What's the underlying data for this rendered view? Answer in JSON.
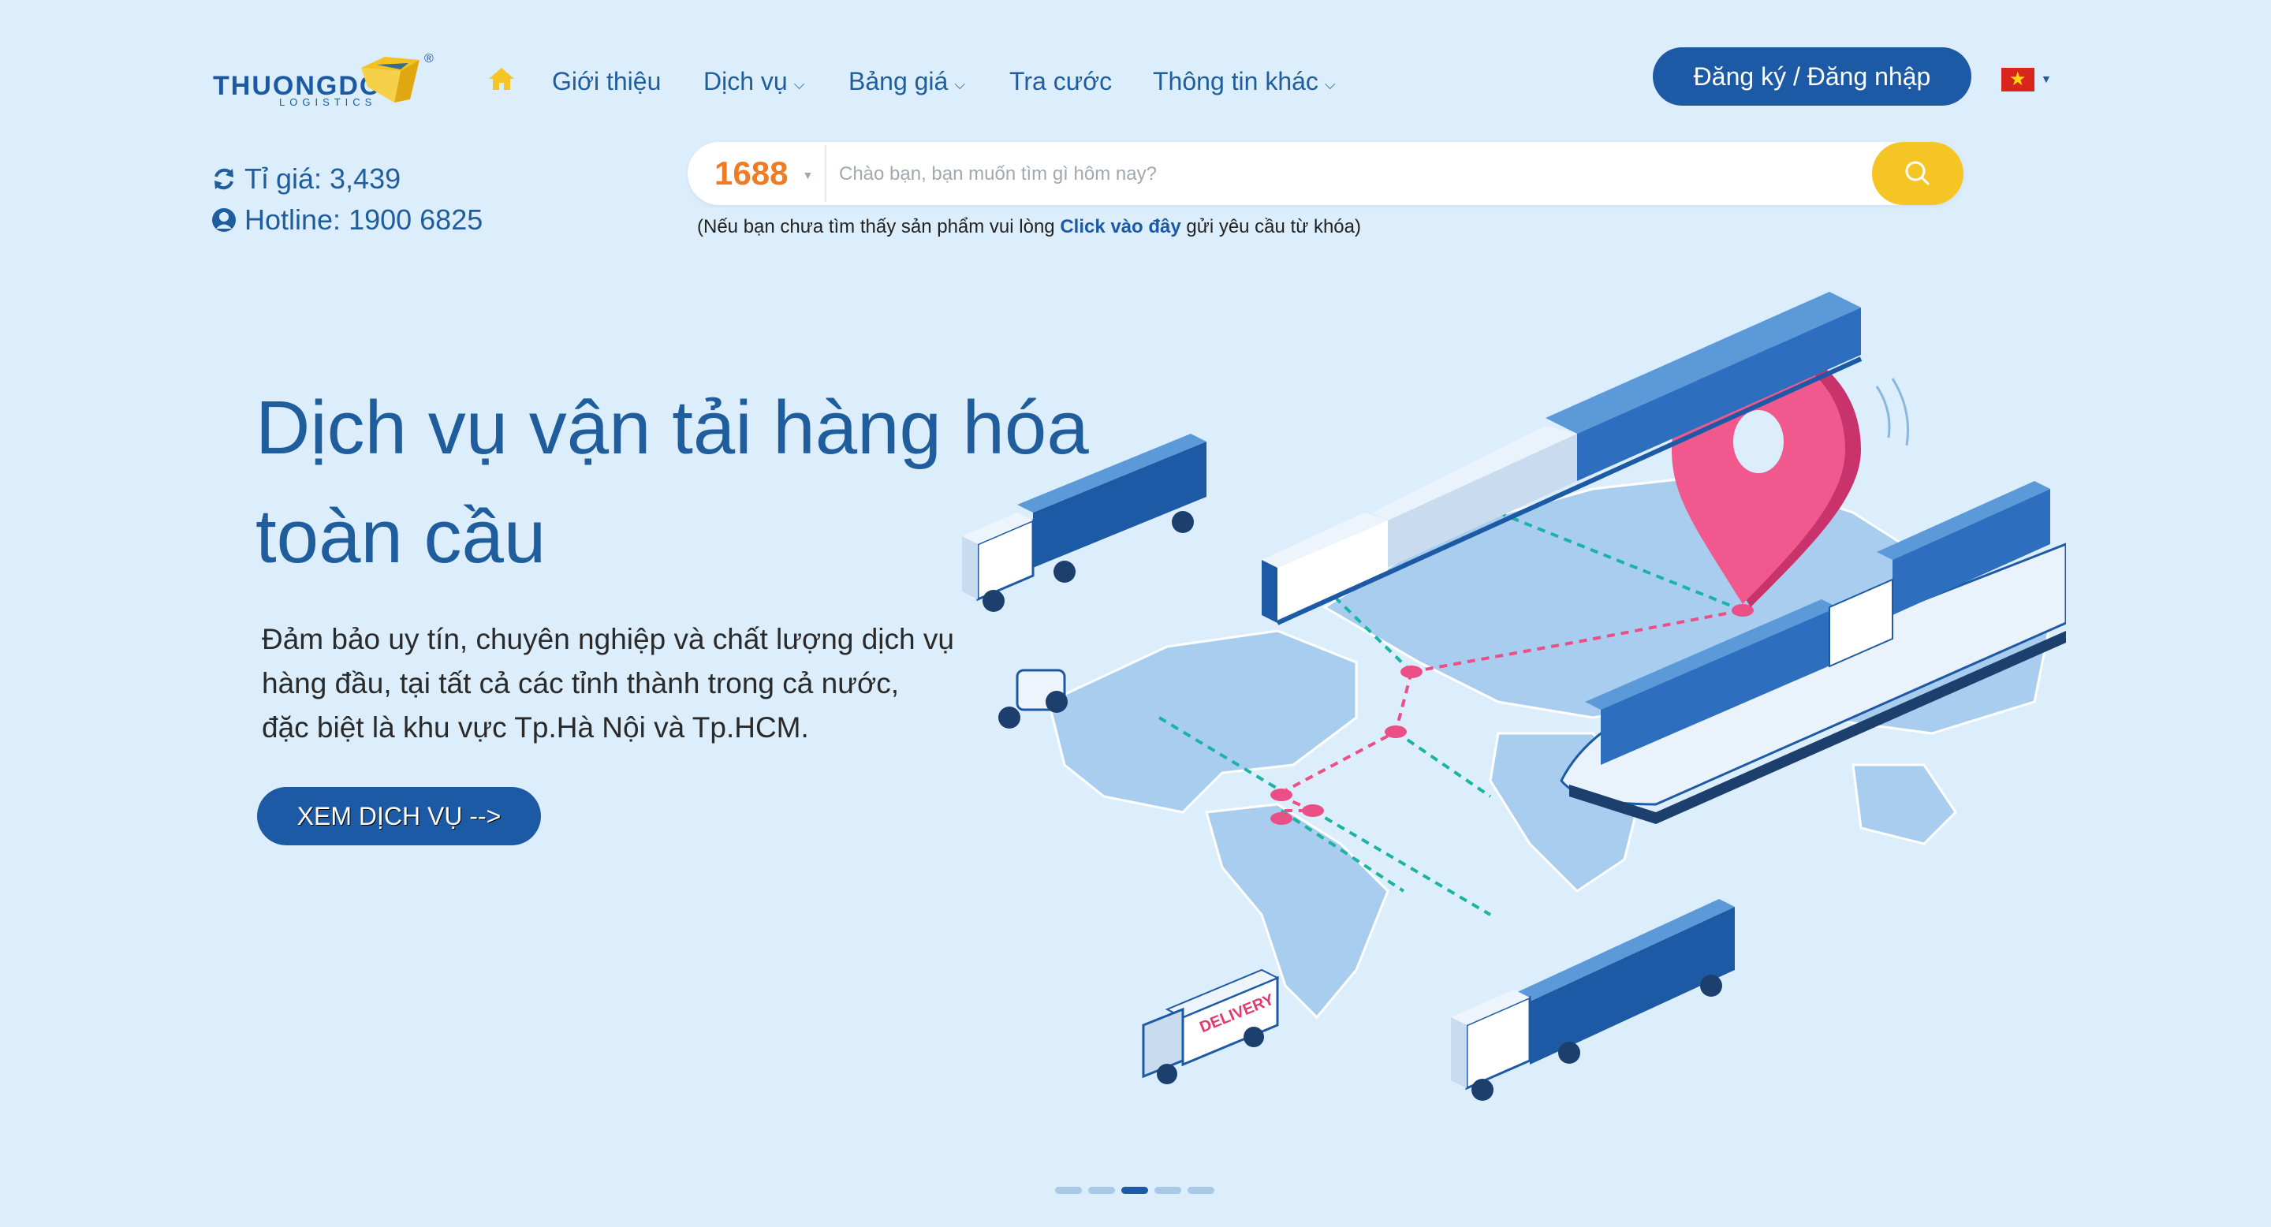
{
  "brand": {
    "name": "THUONGDO",
    "sub": "LOGISTICS"
  },
  "nav": {
    "items": [
      {
        "label": "Giới thiệu",
        "dropdown": false
      },
      {
        "label": "Dịch vụ",
        "dropdown": true
      },
      {
        "label": "Bảng giá",
        "dropdown": true
      },
      {
        "label": "Tra cước",
        "dropdown": false
      },
      {
        "label": "Thông tin khác",
        "dropdown": true
      }
    ],
    "auth_label": "Đăng ký / Đăng nhập",
    "language_icon": "vietnam-flag-icon"
  },
  "info": {
    "rate": "Tỉ giá: 3,439",
    "hotline": "Hotline: 1900 6825"
  },
  "search": {
    "source": "1688",
    "placeholder": "Chào bạn, bạn muốn tìm gì hôm nay?",
    "hint_before": "(Nếu bạn chưa tìm thấy sản phẩm vui lòng ",
    "hint_link": "Click vào đây",
    "hint_after": " gửi yêu cầu từ khóa)"
  },
  "hero": {
    "title_line1": "Dịch vụ vận tải hàng hóa",
    "title_line2": "toàn cầu",
    "desc_line1": "Đảm bảo uy tín, chuyên nghiệp và chất lượng dịch vụ",
    "desc_line2": "hàng đầu, tại tất cả các tỉnh thành trong cả nước,",
    "desc_line3": "đặc biệt là khu vực Tp.Hà Nội và Tp.HCM.",
    "cta_label": "XEM DỊCH VỤ -->",
    "van_label": "DELIVERY"
  },
  "carousel": {
    "count": 5,
    "active_index": 2
  },
  "colors": {
    "background": "#dceefc",
    "primary": "#1d5aa5",
    "accent_yellow": "#f5c526",
    "accent_orange": "#ef7c22",
    "pin_pink": "#f0588e"
  }
}
